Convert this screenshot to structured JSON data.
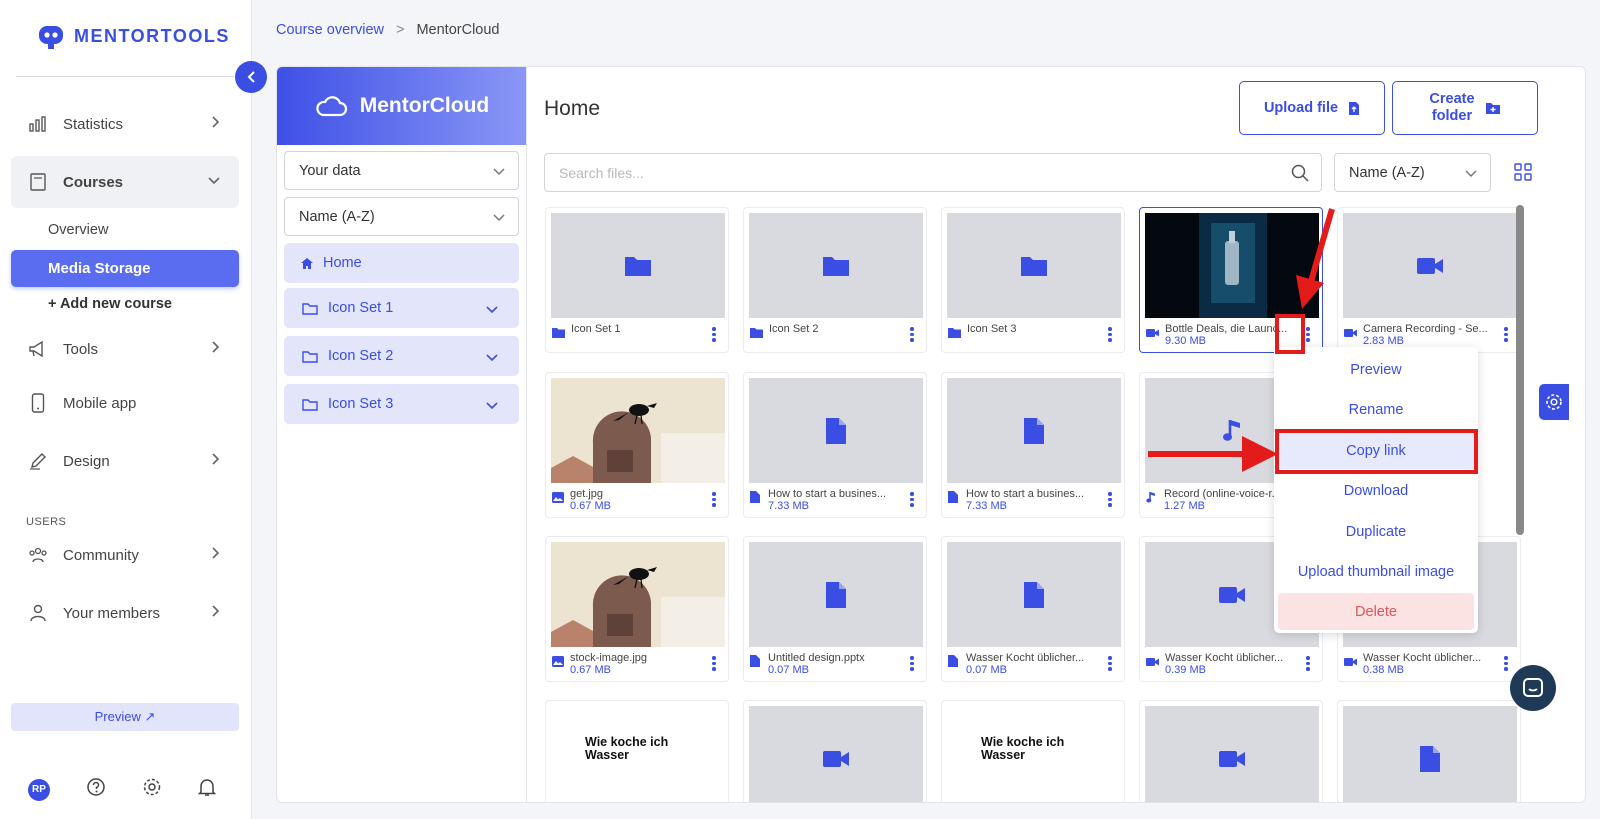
{
  "brand": {
    "name": "MENTORTOOLS",
    "accent": "#3b4ee4"
  },
  "sidebar": {
    "items": [
      {
        "label": "Statistics"
      },
      {
        "label": "Courses"
      },
      {
        "label": "Tools"
      },
      {
        "label": "Mobile app"
      },
      {
        "label": "Design"
      },
      {
        "label": "Community"
      },
      {
        "label": "Your members"
      }
    ],
    "courses_sub": {
      "overview": "Overview",
      "media_storage": "Media Storage",
      "add_course": "+ Add new course"
    },
    "users_section": "USERS",
    "preview_label": "Preview ↗",
    "avatar_initials": "RP"
  },
  "breadcrumb": {
    "parent": "Course overview",
    "separator": ">",
    "current": "MentorCloud"
  },
  "left_panel": {
    "title": "MentorCloud",
    "data_select": "Your data",
    "sort_select": "Name (A-Z)",
    "folders": [
      "Home",
      "Icon Set 1",
      "Icon Set 2",
      "Icon Set 3"
    ]
  },
  "main": {
    "title": "Home",
    "upload_label": "Upload file",
    "create_folder_label": "Create\nfolder",
    "search_placeholder": "Search files...",
    "sort_label": "Name (A-Z)"
  },
  "files": [
    {
      "name": "Icon Set 1",
      "size": "",
      "kind": "folder"
    },
    {
      "name": "Icon Set 2",
      "size": "",
      "kind": "folder"
    },
    {
      "name": "Icon Set 3",
      "size": "",
      "kind": "folder"
    },
    {
      "name": "Bottle Deals, die Launc...",
      "size": "9.30 MB",
      "kind": "video"
    },
    {
      "name": "Camera Recording - Se...",
      "size": "2.83 MB",
      "kind": "video"
    },
    {
      "name": "get.jpg",
      "size": "0.67 MB",
      "kind": "image"
    },
    {
      "name": "How to start a busines...",
      "size": "7.33 MB",
      "kind": "doc"
    },
    {
      "name": "How to start a busines...",
      "size": "7.33 MB",
      "kind": "doc"
    },
    {
      "name": "Record (online-voice-r...",
      "size": "1.27 MB",
      "kind": "audio"
    },
    {
      "name": "",
      "size": "",
      "kind": "hidden"
    },
    {
      "name": "stock-image.jpg",
      "size": "0.67 MB",
      "kind": "image"
    },
    {
      "name": "Untitled design.pptx",
      "size": "0.07 MB",
      "kind": "doc"
    },
    {
      "name": "Wasser Kocht üblicher...",
      "size": "0.07 MB",
      "kind": "doc"
    },
    {
      "name": "Wasser Kocht üblicher...",
      "size": "0.39 MB",
      "kind": "video"
    },
    {
      "name": "Wasser Kocht üblicher...",
      "size": "0.38 MB",
      "kind": "video"
    },
    {
      "name": "",
      "size": "",
      "kind": "text-thumb"
    },
    {
      "name": "",
      "size": "",
      "kind": "video"
    },
    {
      "name": "",
      "size": "",
      "kind": "text-thumb"
    },
    {
      "name": "",
      "size": "",
      "kind": "video"
    },
    {
      "name": "",
      "size": "",
      "kind": "doc"
    }
  ],
  "thumb_text": "Wie koche ich\nWasser",
  "context_menu": [
    "Preview",
    "Rename",
    "Copy link",
    "Download",
    "Duplicate",
    "Upload thumbnail image",
    "Delete"
  ]
}
